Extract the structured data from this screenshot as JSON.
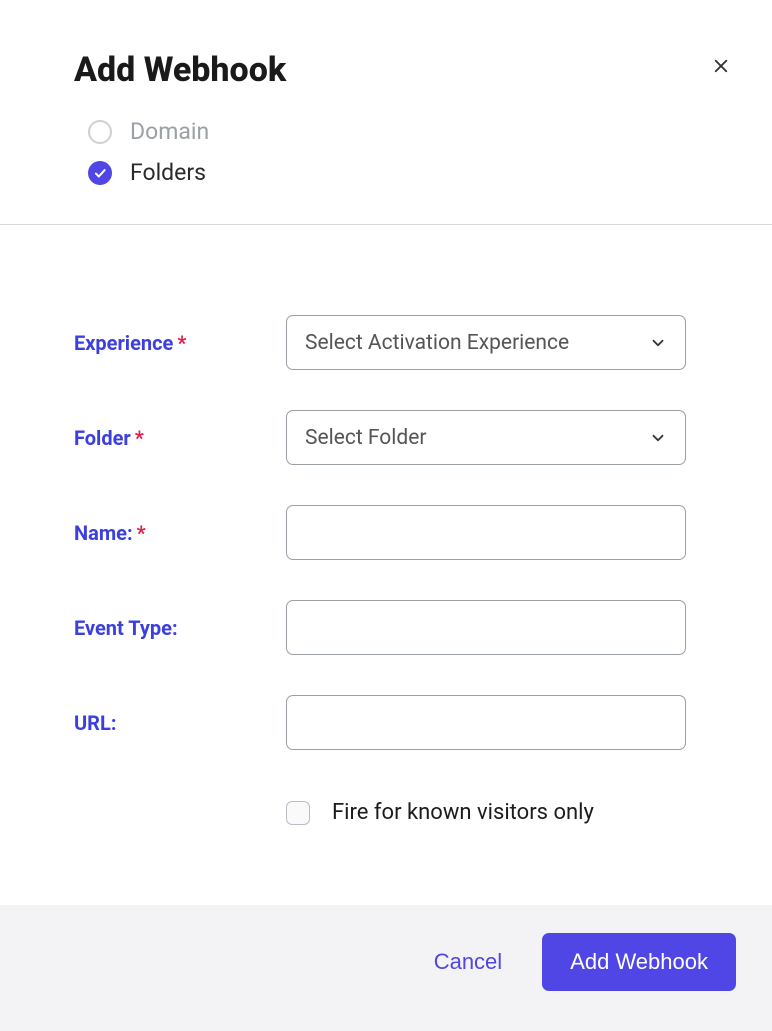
{
  "dialog": {
    "title": "Add Webhook"
  },
  "scope": {
    "options": {
      "domain": {
        "label": "Domain",
        "selected": false
      },
      "folders": {
        "label": "Folders",
        "selected": true
      }
    }
  },
  "form": {
    "experience": {
      "label": "Experience",
      "required": true,
      "placeholder": "Select Activation Experience",
      "value": ""
    },
    "folder": {
      "label": "Folder",
      "required": true,
      "placeholder": "Select Folder",
      "value": ""
    },
    "name": {
      "label": "Name:",
      "required": true,
      "value": ""
    },
    "event_type": {
      "label": "Event Type:",
      "required": false,
      "value": ""
    },
    "url": {
      "label": "URL:",
      "required": false,
      "value": ""
    },
    "known_visitors": {
      "label": "Fire for known visitors only",
      "checked": false
    }
  },
  "actions": {
    "cancel": "Cancel",
    "submit": "Add Webhook"
  }
}
